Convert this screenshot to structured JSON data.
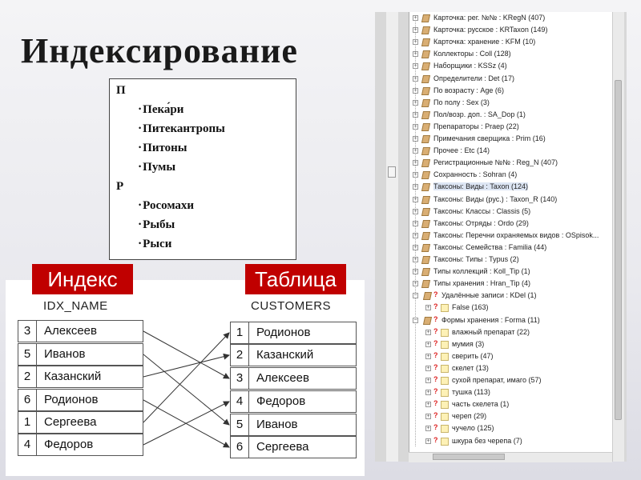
{
  "title": "Индексирование",
  "glossary": [
    {
      "letter": "П",
      "terms": [
        "Пека́ри",
        "Питекантропы",
        "Питоны",
        "Пумы"
      ]
    },
    {
      "letter": "Р",
      "terms": [
        "Росомахи",
        "Рыбы",
        "Рыси"
      ]
    }
  ],
  "index_table": {
    "tag": "Индекс",
    "caption": "IDX_NAME",
    "rows": [
      {
        "num": "3",
        "name": "Алексеев"
      },
      {
        "num": "5",
        "name": "Иванов"
      },
      {
        "num": "2",
        "name": "Казанский"
      },
      {
        "num": "6",
        "name": "Родионов"
      },
      {
        "num": "1",
        "name": "Сергеева"
      },
      {
        "num": "4",
        "name": "Федоров"
      }
    ]
  },
  "data_table": {
    "tag": "Таблица",
    "caption": "CUSTOMERS",
    "rows": [
      {
        "num": "1",
        "name": "Родионов"
      },
      {
        "num": "2",
        "name": "Казанский"
      },
      {
        "num": "3",
        "name": "Алексеев"
      },
      {
        "num": "4",
        "name": "Федоров"
      },
      {
        "num": "5",
        "name": "Иванов"
      },
      {
        "num": "6",
        "name": "Сергеева"
      }
    ]
  },
  "tree": {
    "top_items": [
      "Карточка: рег. №№ : KRegN (407)",
      "Карточка: русское : KRTaxon (149)",
      "Карточка: хранение : KFM (10)",
      "Коллекторы : Coll (128)",
      "Наборщики : KSSz (4)",
      "Определители : Det (17)",
      "По возрасту : Age (6)",
      "По полу : Sex (3)",
      "Пол/возр. доп. : SA_Dop (1)",
      "Препараторы : Praep (22)",
      "Примечания сверщика : Prim (16)",
      "Прочее : Etc (14)",
      "Регистрационные №№ : Reg_N (407)",
      "Сохранность : Sohran (4)",
      "Таксоны: Виды : Taxon (124)",
      "Таксоны: Виды (рус.) : Taxon_R (140)",
      "Таксоны: Классы : Classis (5)",
      "Таксоны: Отряды : Ordo (29)",
      "Таксоны: Перечни охраняемых видов : OSpisok...",
      "Таксоны: Семейства : Familia (44)",
      "Таксоны: Типы : Typus (2)",
      "Типы коллекций : Koll_Tip (1)",
      "Типы хранения : Hran_Tip (4)"
    ],
    "deleted_group": "Удалённые записи : KDel (1)",
    "deleted_children": [
      "False (163)"
    ],
    "forms_group": "Формы хранения : Forma (11)",
    "forms_children": [
      "влажный препарат (22)",
      "мумия (3)",
      "сверить (47)",
      "скелет (13)",
      "сухой препарат, имаго (57)",
      "тушка (113)",
      "часть скелета (1)",
      "череп (29)",
      "чучело (125)",
      "шкура без черепа (7)"
    ],
    "selected": "Таксоны: Виды : Taxon (124)"
  }
}
